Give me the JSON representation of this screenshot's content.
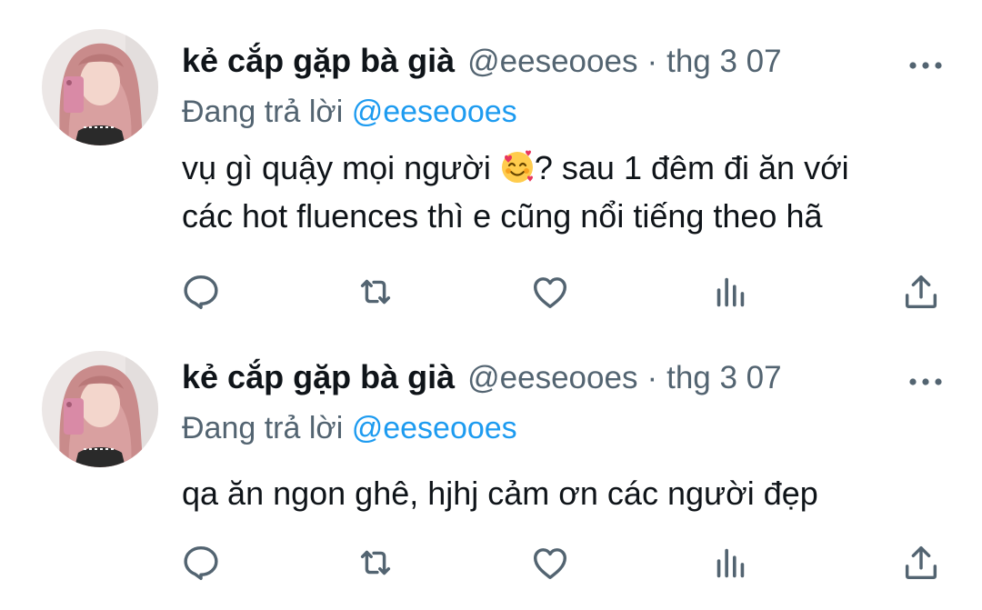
{
  "tweets": [
    {
      "author_name": "kẻ cắp gặp bà già",
      "handle": "@eeseooes",
      "separator": "·",
      "date": "thg 3 07",
      "reply_prefix": "Đang trả lời ",
      "reply_to": "@eeseooes",
      "text_line1_a": "vụ gì quậy mọi người ",
      "text_line1_b": "? sau 1 đêm đi ăn với",
      "text_line2": "các hot fluences thì e cũng nổi tiếng theo hã",
      "emoji": "smiling-face-with-hearts"
    },
    {
      "author_name": "kẻ cắp gặp bà già",
      "handle": "@eeseooes",
      "separator": "·",
      "date": "thg 3 07",
      "reply_prefix": "Đang trả lời ",
      "reply_to": "@eeseooes",
      "text_line1": "qa ăn ngon ghê, hjhj cảm ơn các người đẹp"
    }
  ],
  "icons": {
    "reply": "reply-icon",
    "retweet": "retweet-icon",
    "like": "like-icon",
    "views": "views-icon",
    "share": "share-icon",
    "more": "more-icon"
  },
  "colors": {
    "text": "#0f1419",
    "secondary": "#536471",
    "link": "#1d9bf0"
  }
}
